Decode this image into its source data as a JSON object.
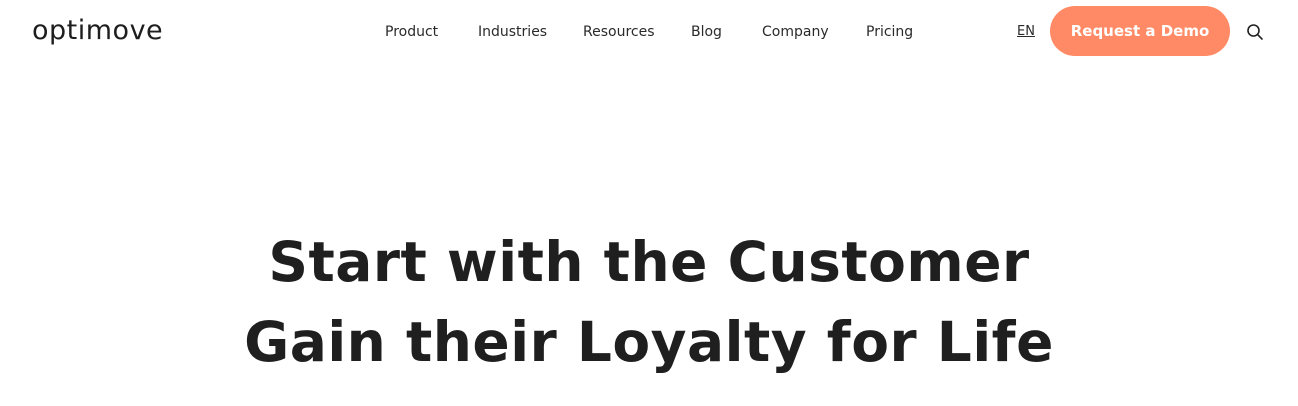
{
  "header": {
    "logo_text": "optimove",
    "nav": [
      {
        "label": "Product"
      },
      {
        "label": "Industries"
      },
      {
        "label": "Resources"
      },
      {
        "label": "Blog"
      },
      {
        "label": "Company"
      },
      {
        "label": "Pricing"
      }
    ],
    "language": "EN",
    "cta_label": "Request a Demo",
    "search_icon": "search-icon"
  },
  "hero": {
    "line1": "Start with the Customer",
    "line2": "Gain their Loyalty for Life"
  },
  "colors": {
    "cta_background": "#ff8a65",
    "text": "#1f1f1f",
    "background": "#ffffff"
  }
}
